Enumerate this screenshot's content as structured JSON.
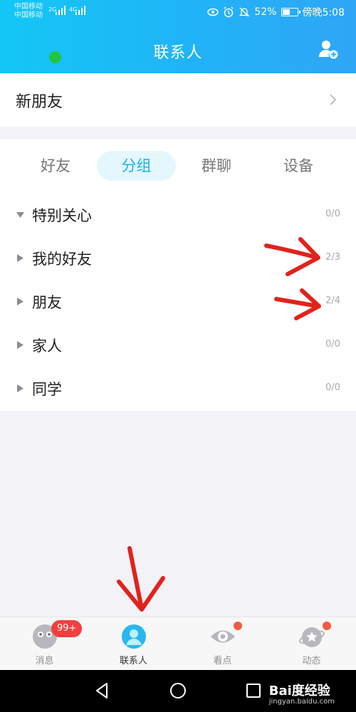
{
  "status_bar": {
    "carrier1": "中国移动",
    "carrier2": "中国移动",
    "net1": "2G",
    "net2": "4G",
    "battery_percent": "52%",
    "battery_level": 0.52,
    "time": "傍晚5:08"
  },
  "header": {
    "title": "联系人"
  },
  "new_friends": {
    "label": "新朋友"
  },
  "tabs": [
    {
      "label": "好友",
      "active": false
    },
    {
      "label": "分组",
      "active": true
    },
    {
      "label": "群聊",
      "active": false
    },
    {
      "label": "设备",
      "active": false
    }
  ],
  "groups": [
    {
      "name": "特别关心",
      "count": "0/0",
      "expanded": true
    },
    {
      "name": "我的好友",
      "count": "2/3",
      "expanded": false
    },
    {
      "name": "朋友",
      "count": "2/4",
      "expanded": false
    },
    {
      "name": "家人",
      "count": "0/0",
      "expanded": false
    },
    {
      "name": "同学",
      "count": "0/0",
      "expanded": false
    }
  ],
  "bottom_nav": [
    {
      "label": "消息",
      "icon": "messages-icon",
      "badge": "99+"
    },
    {
      "label": "联系人",
      "icon": "contacts-icon",
      "active": true
    },
    {
      "label": "看点",
      "icon": "kandian-eye-icon",
      "dot": true
    },
    {
      "label": "动态",
      "icon": "planet-star-icon",
      "dot": true
    }
  ],
  "watermark": {
    "brand": "Bai度经验",
    "url": "jingyan.baidu.com"
  },
  "colors": {
    "header_start": "#13c7f5",
    "header_end": "#2fa6f6",
    "accent": "#14b4e6",
    "annotation": "#e0231c"
  }
}
